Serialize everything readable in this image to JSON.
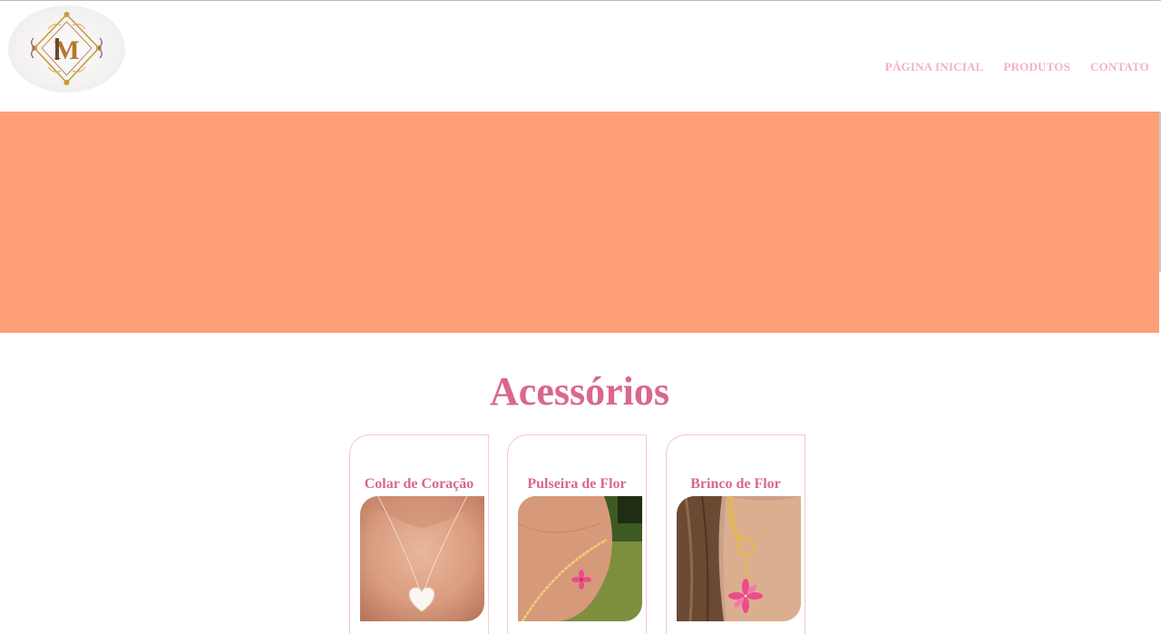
{
  "brand": {
    "logo_icon": "monogram-logo-icon",
    "monogram": "M"
  },
  "nav": {
    "items": [
      {
        "label": "PÁGINA INICIAL"
      },
      {
        "label": "PRODUTOS"
      },
      {
        "label": "CONTATO"
      }
    ]
  },
  "colors": {
    "banner": "#ff9f7a",
    "accent": "#d9678f",
    "nav": "#f2b3bf",
    "card_border": "#f7c6d2"
  },
  "section": {
    "title": "Acessórios"
  },
  "products": [
    {
      "name": "Colar de Coração",
      "image_icon": "heart-necklace-image"
    },
    {
      "name": "Pulseira de Flor",
      "image_icon": "flower-bracelet-image"
    },
    {
      "name": "Brinco de Flor",
      "image_icon": "flower-earring-image"
    }
  ]
}
